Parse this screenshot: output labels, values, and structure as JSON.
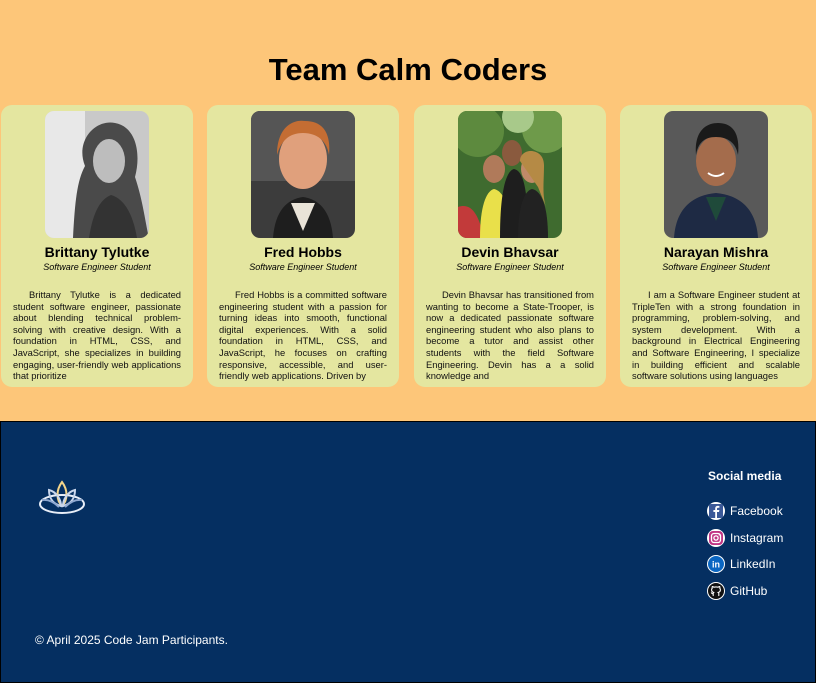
{
  "team": {
    "title": "Team Calm Coders",
    "members": [
      {
        "name": "Brittany Tylutke",
        "role": "Software Engineer Student",
        "bio": "Brittany Tylutke is a dedicated student software engineer, passionate about blending technical problem-solving with creative design. With a foundation in HTML, CSS, and JavaScript, she specializes in building engaging, user-friendly web applications that prioritize"
      },
      {
        "name": "Fred Hobbs",
        "role": "Software Engineer Student",
        "bio": "Fred Hobbs is a committed software engineering student with a passion for turning ideas into smooth, functional digital experiences. With a solid foundation in HTML, CSS, and JavaScript, he focuses on crafting responsive, accessible, and user-friendly web applications. Driven by"
      },
      {
        "name": "Devin Bhavsar",
        "role": "Software Engineer Student",
        "bio": "Devin Bhavsar has transitioned from wanting to become a State-Trooper, is now a dedicated passionate software engineering student who also plans to become a tutor and assist other students with the field Software Engineering. Devin has a a solid knowledge and"
      },
      {
        "name": "Narayan Mishra",
        "role": "Software Engineer Student",
        "bio": "I am a Software Engineer student at TripleTen with a strong foundation in programming, problem-solving, and system development. With a background in Electrical Engineering and Software Engineering, I specialize in building efficient and scalable software solutions using languages"
      }
    ]
  },
  "footer": {
    "social_title": "Social media",
    "links": [
      {
        "label": "Facebook",
        "icon": "facebook-icon"
      },
      {
        "label": "Instagram",
        "icon": "instagram-icon"
      },
      {
        "label": "LinkedIn",
        "icon": "linkedin-icon"
      },
      {
        "label": "GitHub",
        "icon": "github-icon"
      }
    ],
    "copyright": "© April 2025 Code Jam Participants."
  },
  "colors": {
    "hero_bg": "#fdc679",
    "card_bg": "#e4e6a0",
    "footer_bg": "#052f61"
  }
}
